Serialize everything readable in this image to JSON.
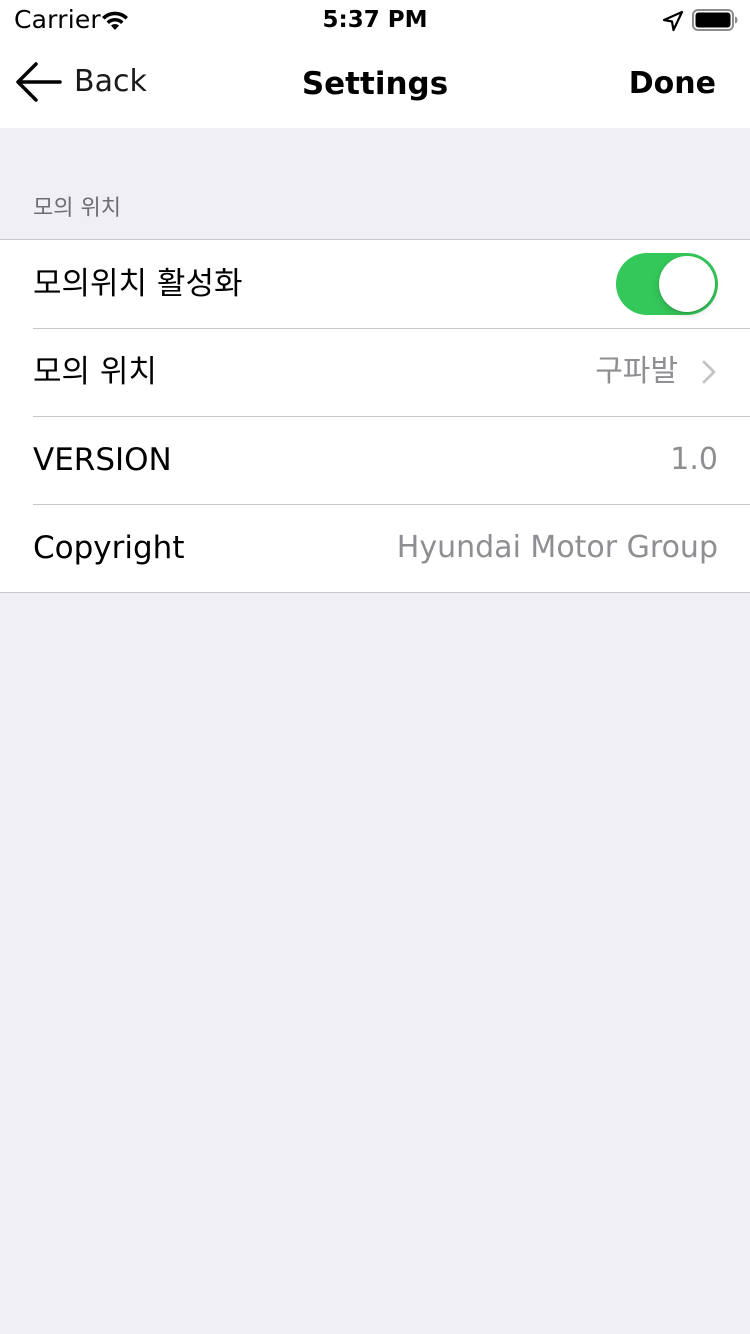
{
  "status_bar": {
    "carrier": "Carrier",
    "time": "5:37 PM",
    "icons": [
      "wifi-icon",
      "location-icon",
      "battery-icon"
    ]
  },
  "nav": {
    "back_label": "Back",
    "title": "Settings",
    "done_label": "Done"
  },
  "section": {
    "header": "모의 위치",
    "rows": [
      {
        "label": "모의위치 활성화",
        "type": "toggle",
        "on": true
      },
      {
        "label": "모의 위치",
        "value": "구파발",
        "type": "disclosure"
      },
      {
        "label": "VERSION",
        "value": "1.0",
        "type": "value"
      },
      {
        "label": "Copyright",
        "value": "Hyundai Motor Group",
        "type": "value"
      }
    ]
  },
  "colors": {
    "toggle_on": "#34c759",
    "background": "#efeff4",
    "secondary_text": "#8e8e93",
    "separator": "#c8c7cc"
  }
}
